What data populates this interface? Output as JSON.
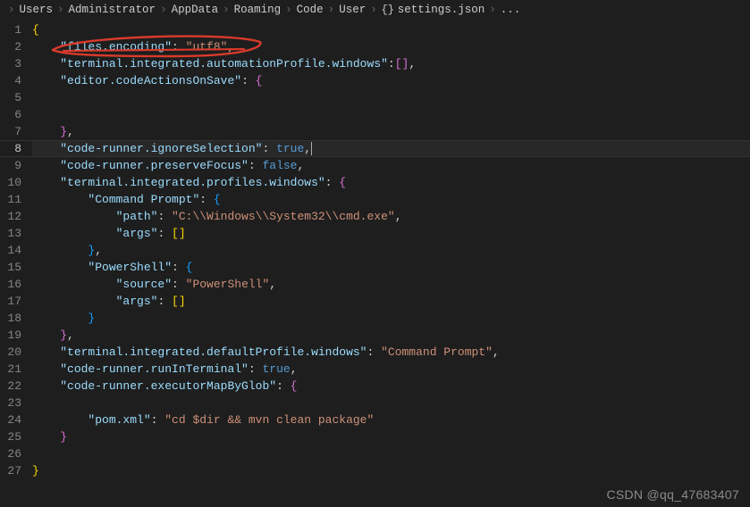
{
  "breadcrumb": {
    "items": [
      "Users",
      "Administrator",
      "AppData",
      "Roaming",
      "Code",
      "User",
      "settings.json",
      "..."
    ],
    "file_icon": "braces-icon"
  },
  "editor": {
    "active_line": 8,
    "lines": [
      {
        "n": 1,
        "indent": 0,
        "t": [
          [
            "brace",
            "{"
          ]
        ]
      },
      {
        "n": 2,
        "indent": 1,
        "t": [
          [
            "key",
            "\"files.encoding\""
          ],
          [
            "punc",
            ": "
          ],
          [
            "string",
            "\"utf8\""
          ],
          [
            "punc",
            ","
          ]
        ]
      },
      {
        "n": 3,
        "indent": 1,
        "t": [
          [
            "key",
            "\"terminal.integrated.automationProfile.windows\""
          ],
          [
            "punc",
            ":"
          ],
          [
            "brace2",
            "[]"
          ],
          [
            "punc",
            ","
          ]
        ]
      },
      {
        "n": 4,
        "indent": 1,
        "t": [
          [
            "key",
            "\"editor.codeActionsOnSave\""
          ],
          [
            "punc",
            ": "
          ],
          [
            "brace2",
            "{"
          ]
        ]
      },
      {
        "n": 5,
        "indent": 0,
        "t": []
      },
      {
        "n": 6,
        "indent": 0,
        "t": []
      },
      {
        "n": 7,
        "indent": 1,
        "t": [
          [
            "brace2",
            "}"
          ],
          [
            "punc",
            ","
          ]
        ]
      },
      {
        "n": 8,
        "indent": 1,
        "t": [
          [
            "key",
            "\"code-runner.ignoreSelection\""
          ],
          [
            "punc",
            ": "
          ],
          [
            "bool",
            "true"
          ],
          [
            "punc",
            ","
          ]
        ],
        "cursor": true
      },
      {
        "n": 9,
        "indent": 1,
        "t": [
          [
            "key",
            "\"code-runner.preserveFocus\""
          ],
          [
            "punc",
            ": "
          ],
          [
            "bool",
            "false"
          ],
          [
            "punc",
            ","
          ]
        ]
      },
      {
        "n": 10,
        "indent": 1,
        "t": [
          [
            "key",
            "\"terminal.integrated.profiles.windows\""
          ],
          [
            "punc",
            ": "
          ],
          [
            "brace2",
            "{"
          ]
        ]
      },
      {
        "n": 11,
        "indent": 2,
        "t": [
          [
            "key",
            "\"Command Prompt\""
          ],
          [
            "punc",
            ": "
          ],
          [
            "brace3",
            "{"
          ]
        ]
      },
      {
        "n": 12,
        "indent": 3,
        "t": [
          [
            "key",
            "\"path\""
          ],
          [
            "punc",
            ": "
          ],
          [
            "string",
            "\"C:\\\\Windows\\\\System32\\\\cmd.exe\""
          ],
          [
            "punc",
            ","
          ]
        ]
      },
      {
        "n": 13,
        "indent": 3,
        "t": [
          [
            "key",
            "\"args\""
          ],
          [
            "punc",
            ": "
          ],
          [
            "brace",
            "[]"
          ]
        ]
      },
      {
        "n": 14,
        "indent": 2,
        "t": [
          [
            "brace3",
            "}"
          ],
          [
            "punc",
            ","
          ]
        ]
      },
      {
        "n": 15,
        "indent": 2,
        "t": [
          [
            "key",
            "\"PowerShell\""
          ],
          [
            "punc",
            ": "
          ],
          [
            "brace3",
            "{"
          ]
        ]
      },
      {
        "n": 16,
        "indent": 3,
        "t": [
          [
            "key",
            "\"source\""
          ],
          [
            "punc",
            ": "
          ],
          [
            "string",
            "\"PowerShell\""
          ],
          [
            "punc",
            ","
          ]
        ]
      },
      {
        "n": 17,
        "indent": 3,
        "t": [
          [
            "key",
            "\"args\""
          ],
          [
            "punc",
            ": "
          ],
          [
            "brace",
            "[]"
          ]
        ]
      },
      {
        "n": 18,
        "indent": 2,
        "t": [
          [
            "brace3",
            "}"
          ]
        ]
      },
      {
        "n": 19,
        "indent": 1,
        "t": [
          [
            "brace2",
            "}"
          ],
          [
            "punc",
            ","
          ]
        ]
      },
      {
        "n": 20,
        "indent": 1,
        "t": [
          [
            "key",
            "\"terminal.integrated.defaultProfile.windows\""
          ],
          [
            "punc",
            ": "
          ],
          [
            "string",
            "\"Command Prompt\""
          ],
          [
            "punc",
            ","
          ]
        ]
      },
      {
        "n": 21,
        "indent": 1,
        "t": [
          [
            "key",
            "\"code-runner.runInTerminal\""
          ],
          [
            "punc",
            ": "
          ],
          [
            "bool",
            "true"
          ],
          [
            "punc",
            ","
          ]
        ]
      },
      {
        "n": 22,
        "indent": 1,
        "t": [
          [
            "key",
            "\"code-runner.executorMapByGlob\""
          ],
          [
            "punc",
            ": "
          ],
          [
            "brace2",
            "{"
          ]
        ]
      },
      {
        "n": 23,
        "indent": 0,
        "t": []
      },
      {
        "n": 24,
        "indent": 2,
        "t": [
          [
            "key",
            "\"pom.xml\""
          ],
          [
            "punc",
            ": "
          ],
          [
            "string",
            "\"cd $dir && mvn clean package\""
          ]
        ]
      },
      {
        "n": 25,
        "indent": 1,
        "t": [
          [
            "brace2",
            "}"
          ]
        ]
      },
      {
        "n": 26,
        "indent": 0,
        "t": []
      },
      {
        "n": 27,
        "indent": 0,
        "t": [
          [
            "brace",
            "}"
          ]
        ]
      }
    ]
  },
  "annotation": {
    "color": "#d93a2b"
  },
  "watermark": "CSDN @qq_47683407"
}
